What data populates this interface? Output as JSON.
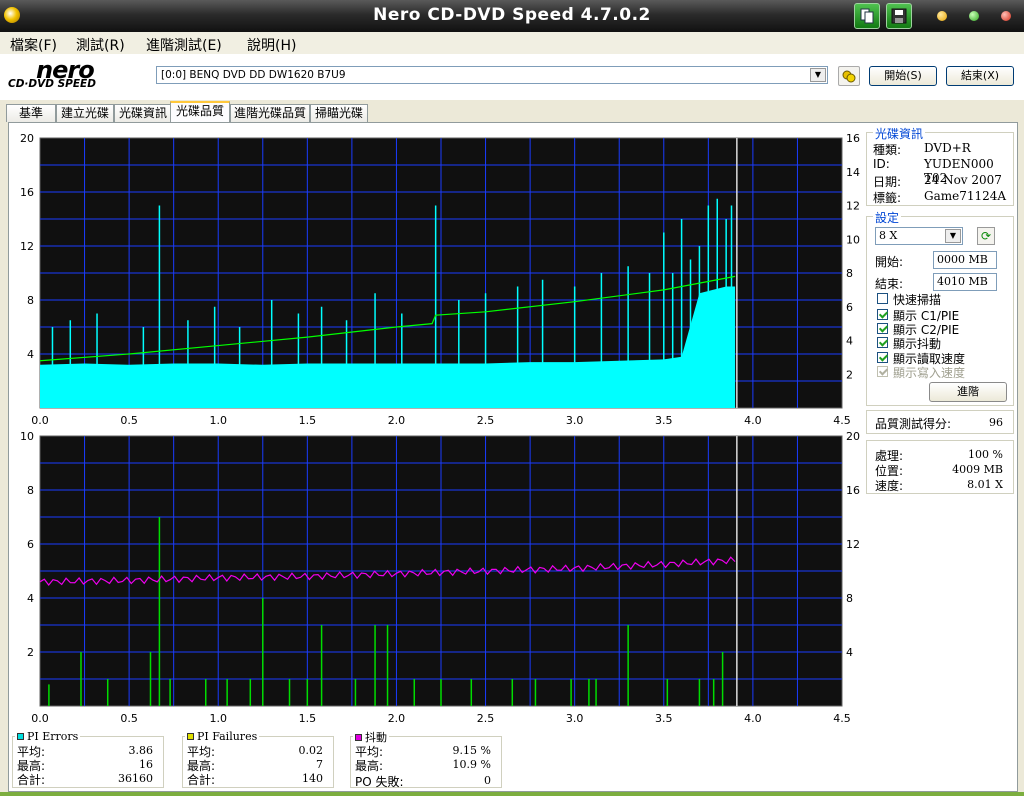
{
  "window": {
    "title": "Nero CD-DVD Speed 4.7.0.2"
  },
  "menu": [
    "檔案(F)",
    "測試(R)",
    "進階測試(E)",
    "說明(H)"
  ],
  "logo": {
    "brand": "nero",
    "product": "CD·DVD SPEED"
  },
  "toolbar": {
    "drive": "[0:0]   BENQ DVD DD DW1620 B7U9",
    "start_label": "開始(S)",
    "end_label": "結束(X)"
  },
  "tabs": [
    "基準",
    "建立光碟",
    "光碟資訊",
    "光碟品質",
    "進階光碟品質",
    "掃瞄光碟"
  ],
  "active_tab": "光碟品質",
  "disc_info": {
    "title": "光碟資訊",
    "rows": [
      {
        "label": "種類:",
        "value": "DVD+R"
      },
      {
        "label": "ID:",
        "value": "YUDEN000 T02"
      },
      {
        "label": "日期:",
        "value": "24 Nov 2007"
      },
      {
        "label": "標籤:",
        "value": "Game71124A"
      }
    ]
  },
  "settings": {
    "title": "設定",
    "speed": "8 X",
    "start_label": "開始:",
    "start_value": "0000 MB",
    "end_label": "結束:",
    "end_value": "4010 MB",
    "checks": [
      {
        "label": "快速掃描",
        "checked": false,
        "disabled": false
      },
      {
        "label": "顯示 C1/PIE",
        "checked": true,
        "disabled": false
      },
      {
        "label": "顯示 C2/PIE",
        "checked": true,
        "disabled": false
      },
      {
        "label": "顯示抖動",
        "checked": true,
        "disabled": false
      },
      {
        "label": "顯示讀取速度",
        "checked": true,
        "disabled": false
      },
      {
        "label": "顯示寫入速度",
        "checked": true,
        "disabled": true
      }
    ],
    "advanced_label": "進階"
  },
  "quality": {
    "label": "品質測試得分:",
    "value": "96"
  },
  "progress": {
    "rows": [
      {
        "label": "處理:",
        "value": "100 %"
      },
      {
        "label": "位置:",
        "value": "4009 MB"
      },
      {
        "label": "速度:",
        "value": "8.01 X"
      }
    ]
  },
  "stats": [
    {
      "title": "PI Errors",
      "color": "#00e0e0",
      "rows": [
        {
          "label": "平均:",
          "value": "3.86"
        },
        {
          "label": "最高:",
          "value": "16"
        },
        {
          "label": "合計:",
          "value": "36160"
        }
      ]
    },
    {
      "title": "PI Failures",
      "color": "#e0e000",
      "rows": [
        {
          "label": "平均:",
          "value": "0.02"
        },
        {
          "label": "最高:",
          "value": "7"
        },
        {
          "label": "合計:",
          "value": "140"
        }
      ]
    },
    {
      "title": "抖動",
      "color": "#e000e0",
      "rows": [
        {
          "label": "平均:",
          "value": "9.15 %"
        },
        {
          "label": "最高:",
          "value": "10.9 %"
        },
        {
          "label": "PO 失敗:",
          "value": "0"
        }
      ]
    }
  ],
  "chart_data": [
    {
      "type": "area",
      "x_ticks": [
        "0.0",
        "0.5",
        "1.0",
        "1.5",
        "2.0",
        "2.5",
        "3.0",
        "3.5",
        "4.0",
        "4.5"
      ],
      "y_ticks": [
        "4",
        "8",
        "12",
        "16",
        "20"
      ],
      "y2_ticks": [
        "2",
        "4",
        "6",
        "8",
        "10",
        "12",
        "14",
        "16"
      ],
      "xlim": [
        0,
        4.5
      ],
      "ylim": [
        0,
        20
      ],
      "y2lim": [
        0,
        16
      ],
      "grid": true,
      "series": [
        {
          "color": "#00ffff",
          "x": [
            0.0,
            0.25,
            0.5,
            0.75,
            1.0,
            1.25,
            1.5,
            1.75,
            2.0,
            2.25,
            2.5,
            2.75,
            3.0,
            3.25,
            3.5,
            3.6,
            3.7,
            3.85,
            3.9
          ],
          "values": [
            3.2,
            3.3,
            3.2,
            3.3,
            3.3,
            3.2,
            3.3,
            3.3,
            3.3,
            3.3,
            3.3,
            3.4,
            3.4,
            3.5,
            3.6,
            3.8,
            8.5,
            9.0,
            9.0
          ]
        },
        {
          "color": "#00ff00",
          "x": [
            0.0,
            0.5,
            1.0,
            1.5,
            2.0,
            2.2,
            2.22,
            2.5,
            3.0,
            3.5,
            3.9
          ],
          "values": [
            2.8,
            3.2,
            3.7,
            4.2,
            4.8,
            5.0,
            5.5,
            5.7,
            6.3,
            7.0,
            7.8
          ]
        },
        {
          "color": "#00ff00",
          "x": [
            0.67,
            2.2
          ],
          "values": [
            15,
            15
          ]
        }
      ],
      "spikes_x": [
        0.07,
        0.17,
        0.32,
        0.58,
        0.67,
        0.83,
        0.98,
        1.12,
        1.3,
        1.45,
        1.58,
        1.72,
        1.88,
        2.03,
        2.22,
        2.35,
        2.5,
        2.68,
        2.82,
        3.0,
        3.15,
        3.3,
        3.42,
        3.5,
        3.55,
        3.6,
        3.65,
        3.7,
        3.75,
        3.8,
        3.85,
        3.88
      ],
      "spikes_y": [
        6,
        6.5,
        7,
        6,
        15,
        6.5,
        7.5,
        6,
        8,
        7,
        7.5,
        6.5,
        8.5,
        7,
        15,
        8,
        8.5,
        9,
        9.5,
        9,
        10,
        10.5,
        10,
        13,
        10,
        14,
        11,
        12,
        15,
        15.5,
        14,
        15
      ],
      "marker_x": 3.91
    },
    {
      "type": "bar",
      "x_ticks": [
        "0.0",
        "0.5",
        "1.0",
        "1.5",
        "2.0",
        "2.5",
        "3.0",
        "3.5",
        "4.0",
        "4.5"
      ],
      "y_ticks": [
        "2",
        "4",
        "6",
        "8",
        "10"
      ],
      "y2_ticks": [
        "4",
        "8",
        "12",
        "16",
        "20"
      ],
      "xlim": [
        0,
        4.5
      ],
      "ylim": [
        0,
        10
      ],
      "y2lim": [
        0,
        20
      ],
      "grid": true,
      "bars": {
        "color": "#00dd00",
        "x": [
          0.05,
          0.23,
          0.38,
          0.62,
          0.67,
          0.73,
          0.93,
          1.05,
          1.18,
          1.25,
          1.4,
          1.5,
          1.58,
          1.77,
          1.88,
          1.95,
          2.1,
          2.25,
          2.42,
          2.65,
          2.78,
          2.98,
          3.08,
          3.12,
          3.3,
          3.52,
          3.7,
          3.78,
          3.83
        ],
        "values": [
          0.8,
          2,
          1,
          2,
          7,
          1,
          1,
          1,
          1,
          4,
          1,
          1,
          3,
          1,
          3,
          3,
          1,
          1,
          1,
          1,
          1,
          1,
          1,
          1,
          3,
          1,
          1,
          1,
          2
        ]
      },
      "series": [
        {
          "name": "抖動",
          "color": "#ee00ee",
          "x": [
            0.0,
            0.5,
            1.0,
            1.5,
            2.0,
            2.5,
            3.0,
            3.5,
            3.9
          ],
          "values": [
            9.2,
            9.3,
            9.5,
            9.6,
            9.8,
            10.0,
            10.2,
            10.5,
            10.8
          ]
        }
      ],
      "marker_x": 3.91
    }
  ]
}
